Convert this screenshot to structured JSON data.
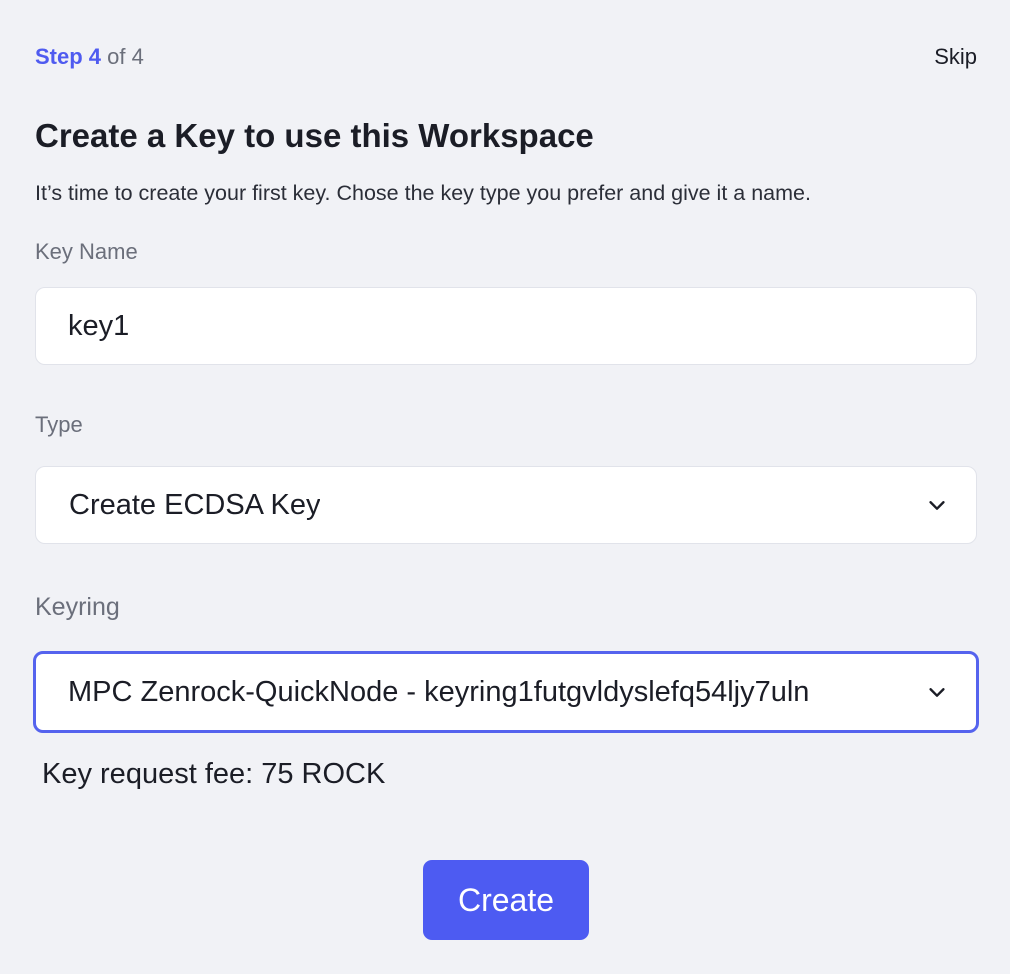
{
  "header": {
    "step_word": "Step 4",
    "step_total": "of 4",
    "skip_label": "Skip"
  },
  "title": "Create a Key to use this Workspace",
  "subtitle": "It’s time to create your first key. Chose the key type you prefer and give it a name.",
  "key_name": {
    "label": "Key Name",
    "value": "key1"
  },
  "type": {
    "label": "Type",
    "selected": "Create ECDSA Key"
  },
  "keyring": {
    "label": "Keyring",
    "selected": "MPC Zenrock-QuickNode - keyring1futgvldyslefq54ljy7uln"
  },
  "fee_text": "Key request fee: 75 ROCK",
  "create_label": "Create",
  "colors": {
    "accent": "#4d5bf2",
    "background": "#f1f2f6",
    "focus_border": "#5563ee"
  },
  "icons": {
    "dropdown": "chevron-down-icon"
  }
}
